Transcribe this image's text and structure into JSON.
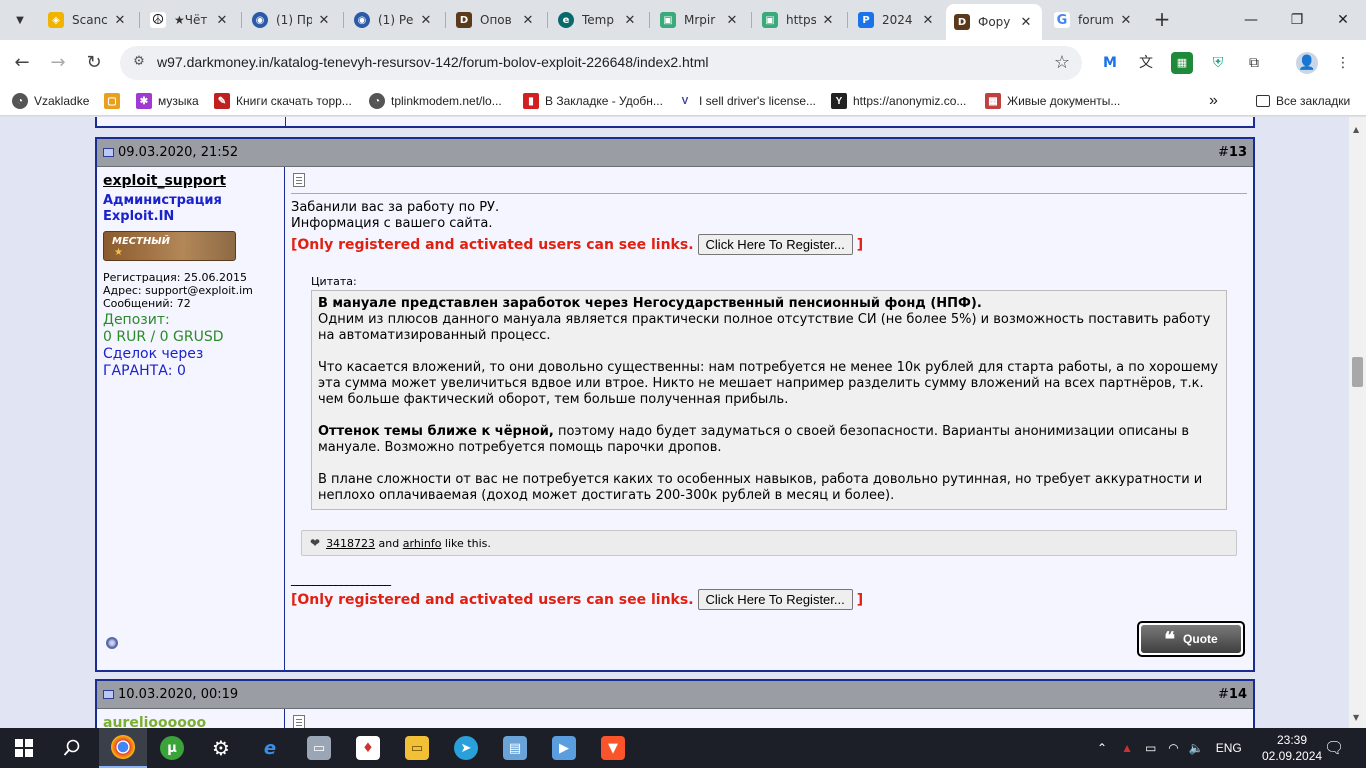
{
  "browser": {
    "tabs": [
      {
        "label": "Scanc",
        "fav_color": "#f0b400",
        "fav_glyph": "◈"
      },
      {
        "label": "★Чёт",
        "fav_color": "#222222",
        "fav_glyph": "☮"
      },
      {
        "label": "(1) Пр",
        "fav_color": "#2a5aa8",
        "fav_glyph": "◉"
      },
      {
        "label": "(1) Ре",
        "fav_color": "#2a5aa8",
        "fav_glyph": "◉"
      },
      {
        "label": "Опов",
        "fav_color": "#5a3a1a",
        "fav_glyph": "D"
      },
      {
        "label": "Temp",
        "fav_color": "#0a6a6a",
        "fav_glyph": "e"
      },
      {
        "label": "Mrpir",
        "fav_color": "#3aaa7a",
        "fav_glyph": "▣"
      },
      {
        "label": "https",
        "fav_color": "#3aaa7a",
        "fav_glyph": "▣"
      },
      {
        "label": "2024",
        "fav_color": "#1a73e8",
        "fav_glyph": "P"
      },
      {
        "label": "Фору",
        "fav_color": "#5a3a1a",
        "fav_glyph": "D",
        "active": true
      },
      {
        "label": "forum",
        "fav_color": "#ffffff",
        "fav_glyph": "G"
      }
    ],
    "url": "w97.darkmoney.in/katalog-tenevyh-resursov-142/forum-bolov-exploit-226648/index2.html",
    "bookmarks": [
      {
        "label": "Vzakladke",
        "color": "#555555",
        "glyph": "◔"
      },
      {
        "label": "",
        "color": "#e8a020",
        "glyph": "▢"
      },
      {
        "label": "музыка",
        "color": "#a03ad0",
        "glyph": "✱"
      },
      {
        "label": "Книги скачать торр...",
        "color": "#c02020",
        "glyph": "✎"
      },
      {
        "label": "tplinkmodem.net/lo...",
        "color": "#555555",
        "glyph": "◔"
      },
      {
        "label": "В Закладке - Удобн...",
        "color": "#d02020",
        "glyph": "▮"
      },
      {
        "label": "I sell driver's license...",
        "color": "#3a3aa0",
        "glyph": "V"
      },
      {
        "label": "https://anonymiz.co...",
        "color": "#222222",
        "glyph": "Y"
      },
      {
        "label": "Живые документы...",
        "color": "#c04040",
        "glyph": "▦"
      }
    ],
    "bookmarks_more": "»",
    "all_bookmarks": "Все закладки"
  },
  "posts": [
    {
      "date": "09.03.2020, 21:52",
      "number_prefix": "#",
      "number": "13",
      "user": {
        "name": "exploit_support",
        "title_line1": "Администрация",
        "title_line2": "Exploit.IN",
        "rank": "МЕСТНЫЙ",
        "registration": "Регистрация: 25.06.2015",
        "address": "Адрес: support@exploit.im",
        "messages": "Сообщений: 72",
        "deposit_label": "Депозит:",
        "deposit_value": "0 RUR / 0 GRUSD",
        "deals_label": "Сделок через",
        "deals_value": "ГАРАНТА: 0"
      },
      "message": {
        "line1": "Забанили вас за работу по РУ.",
        "line2": "Информация с вашего сайта.",
        "reg_text": "[Only registered and activated users can see links.",
        "reg_button": "Click Here To Register...",
        "reg_close": "]",
        "quote_label": "Цитата:",
        "quote_p1_bold": "В мануале представлен заработок через Негосударственный пенсионный фонд (НПФ).",
        "quote_p1": "Одним из плюсов данного мануала является практически полное отсутствие СИ (не более 5%) и возможность поставить работу на автоматизированный процесс.",
        "quote_p2": "Что касается вложений, то они довольно существенны: нам потребуется не менее 10к рублей для старта работы, а по хорошему эта сумма может увеличиться вдвое или втрое. Никто не мешает например разделить сумму вложений на всех партнёров, т.к. чем больше фактический оборот, тем больше полученная прибыль.",
        "quote_p3_bold": "Оттенок темы ближе к чёрной,",
        "quote_p3": " поэтому надо будет задуматься о своей безопасности. Варианты анонимизации описаны в мануале. Возможно потребуется помощь парочки дропов.",
        "quote_p4": "В плане сложности от вас не потребуется каких то особенных навыков, работа довольно рутинная, но требует аккуратности и неплохо оплачиваемая (доход может достигать 200-300к рублей в месяц и более).",
        "likes_user1": "3418723",
        "likes_and": " and ",
        "likes_user2": "arhinfo",
        "likes_suffix": " like this.",
        "signature_line": "__________________",
        "quote_button": "Quote"
      }
    },
    {
      "date": "10.03.2020, 00:19",
      "number_prefix": "#",
      "number": "14",
      "user": {
        "name": "aurelioooooo"
      }
    }
  ],
  "taskbar": {
    "lang": "ENG",
    "time": "23:39",
    "date": "02.09.2024"
  }
}
